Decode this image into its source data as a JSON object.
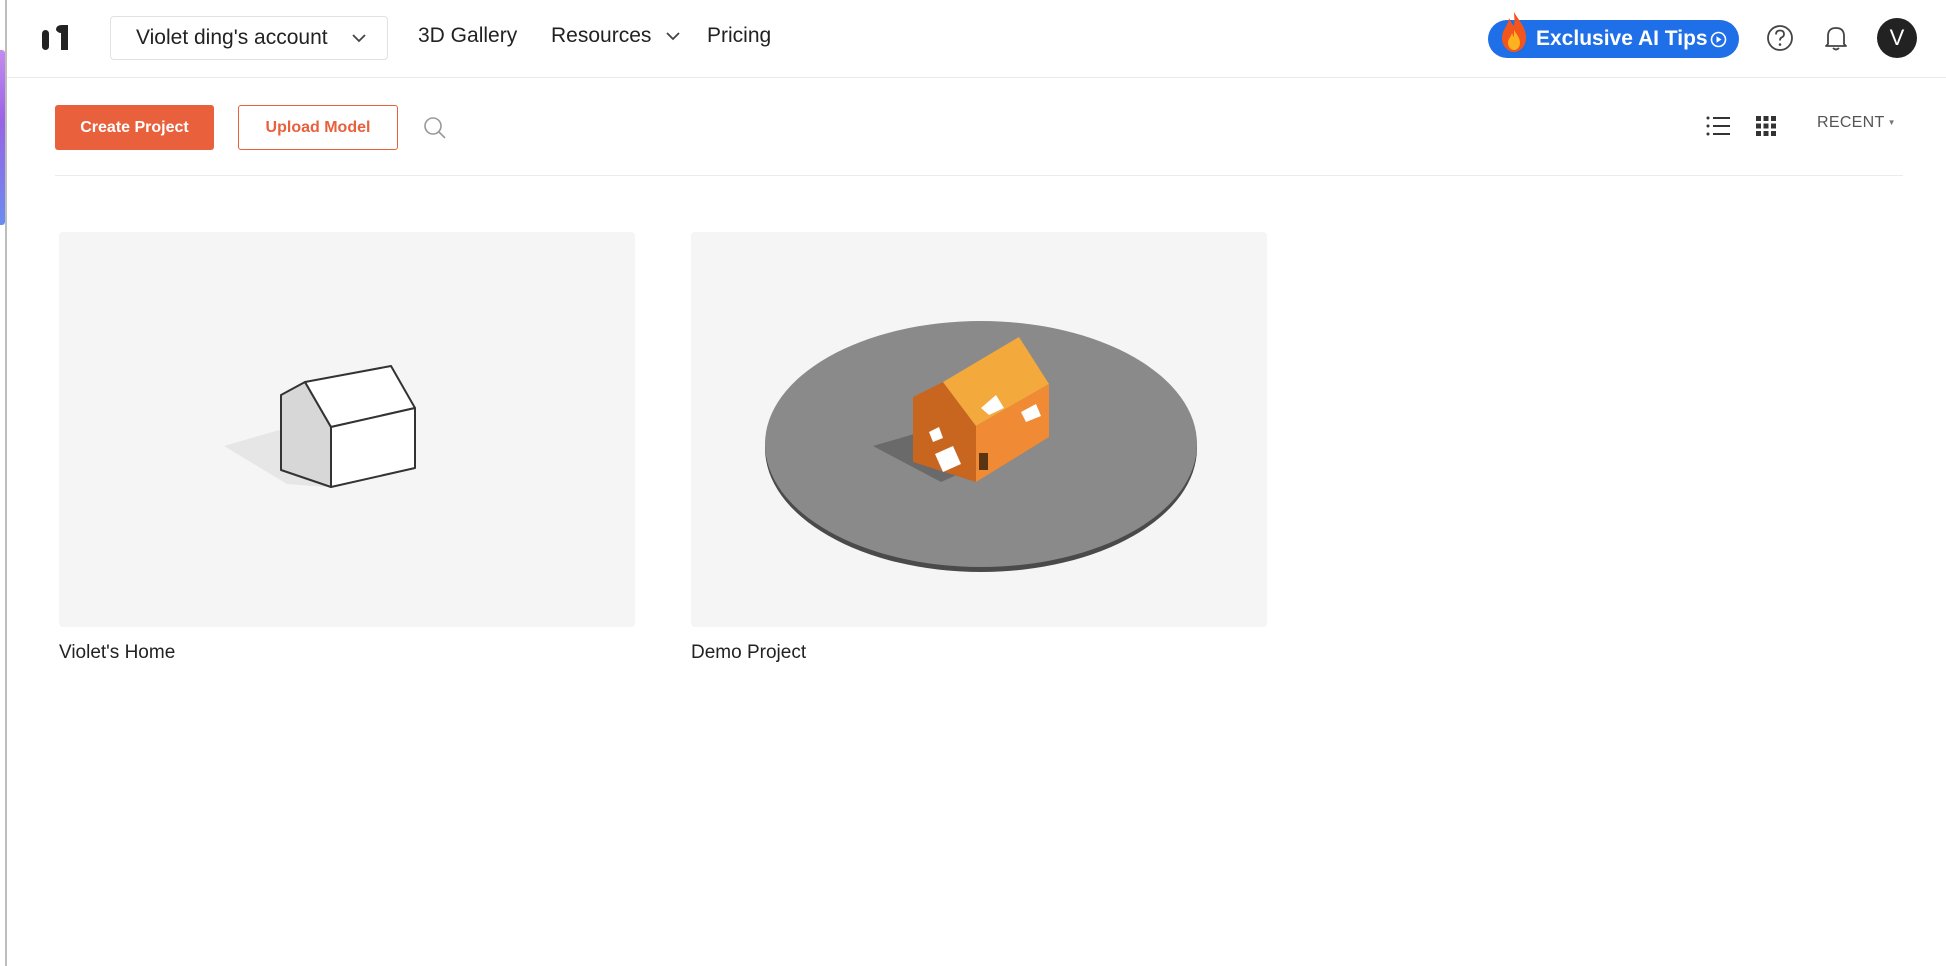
{
  "nav": {
    "account": "Violet ding's account",
    "gallery": "3D Gallery",
    "resources": "Resources",
    "pricing": "Pricing",
    "ai_tips": "Exclusive AI Tips",
    "avatar_initial": "V"
  },
  "toolbar": {
    "create": "Create Project",
    "upload": "Upload Model",
    "sort": "RECENT"
  },
  "projects": [
    {
      "title": "Violet's Home"
    },
    {
      "title": "Demo Project"
    }
  ],
  "colors": {
    "accent": "#e8603c",
    "ai_tips_bg": "#1f6fe8",
    "house_orange": "#f08a35"
  }
}
